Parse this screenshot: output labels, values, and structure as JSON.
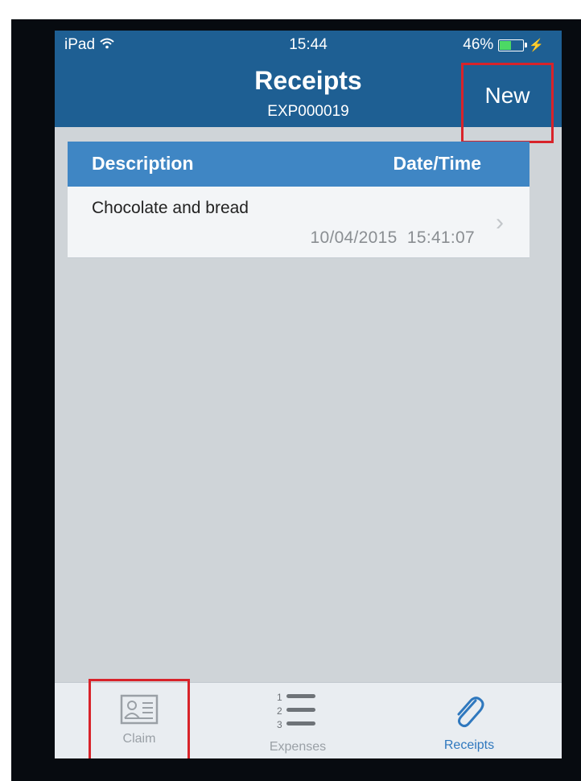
{
  "status_bar": {
    "device": "iPad",
    "time": "15:44",
    "battery": "46%",
    "battery_level": 0.46
  },
  "navbar": {
    "title": "Receipts",
    "subtitle": "EXP000019",
    "new_label": "New"
  },
  "list": {
    "columns": [
      "Description",
      "Date/Time"
    ],
    "rows": [
      {
        "description": "Chocolate and bread",
        "datetime": "10/04/2015  15:41:07"
      }
    ]
  },
  "tabs": [
    {
      "label": "Claim",
      "icon": "id-card-icon"
    },
    {
      "label": "Expenses",
      "icon": "numbered-list-icon"
    },
    {
      "label": "Receipts",
      "icon": "paperclip-icon"
    }
  ],
  "colors": {
    "navbar": "#1e5f93",
    "list_header": "#3f86c4",
    "highlight_box": "#d8232a",
    "active_tab": "#2f78be"
  }
}
